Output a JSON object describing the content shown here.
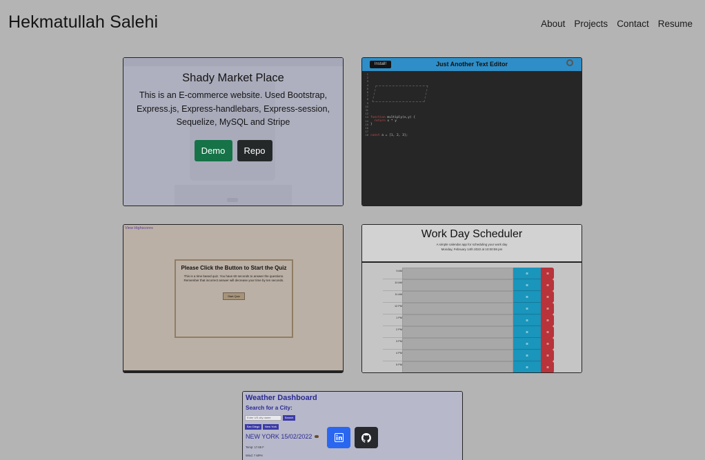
{
  "header": {
    "brand": "Hekmatullah Salehi",
    "nav": [
      "About",
      "Projects",
      "Contact",
      "Resume"
    ]
  },
  "projects": [
    {
      "title": "Shady Market Place",
      "description": "This is an E-commerce website. Used Bootstrap, Express.js, Express-handlebars, Express-session, Sequelize, MySQL and Stripe",
      "demo_label": "Demo",
      "repo_label": "Repo"
    },
    {
      "screenshot": {
        "install_label": "Install!",
        "title": "Just Another Text Editor"
      }
    },
    {
      "screenshot": {
        "link": "View Highscores",
        "title": "Please Click the Button to Start the Quiz",
        "description": "This is a time based quiz. You have 60 seconds to answer the questions. Remember that incorrect answer will decrease your time by ten seconds.",
        "button": "Start Quiz"
      }
    },
    {
      "screenshot": {
        "title": "Work Day Scheduler",
        "subtitle": "A simple calendar app for scheduling your work day",
        "date": "Monday, February 14th 2022 at 10:00:59 pm",
        "hours": [
          "9 AM",
          "10 AM",
          "11 AM",
          "12 PM",
          "1 PM",
          "2 PM",
          "3 PM",
          "4 PM",
          "5 PM"
        ]
      }
    },
    {
      "screenshot": {
        "title": "Weather Dashboard",
        "search_label": "Search for a City:",
        "placeholder": "Enter US city name",
        "search_button": "Search",
        "history": [
          "San Diego",
          "New York"
        ],
        "city": "NEW YORK 15/02/2022",
        "temp": "Temp: 17.65 F",
        "wind": "Wind: 7 MPH"
      }
    }
  ],
  "social": {
    "linkedin_icon": "linkedin-icon",
    "github_icon": "github-icon"
  }
}
